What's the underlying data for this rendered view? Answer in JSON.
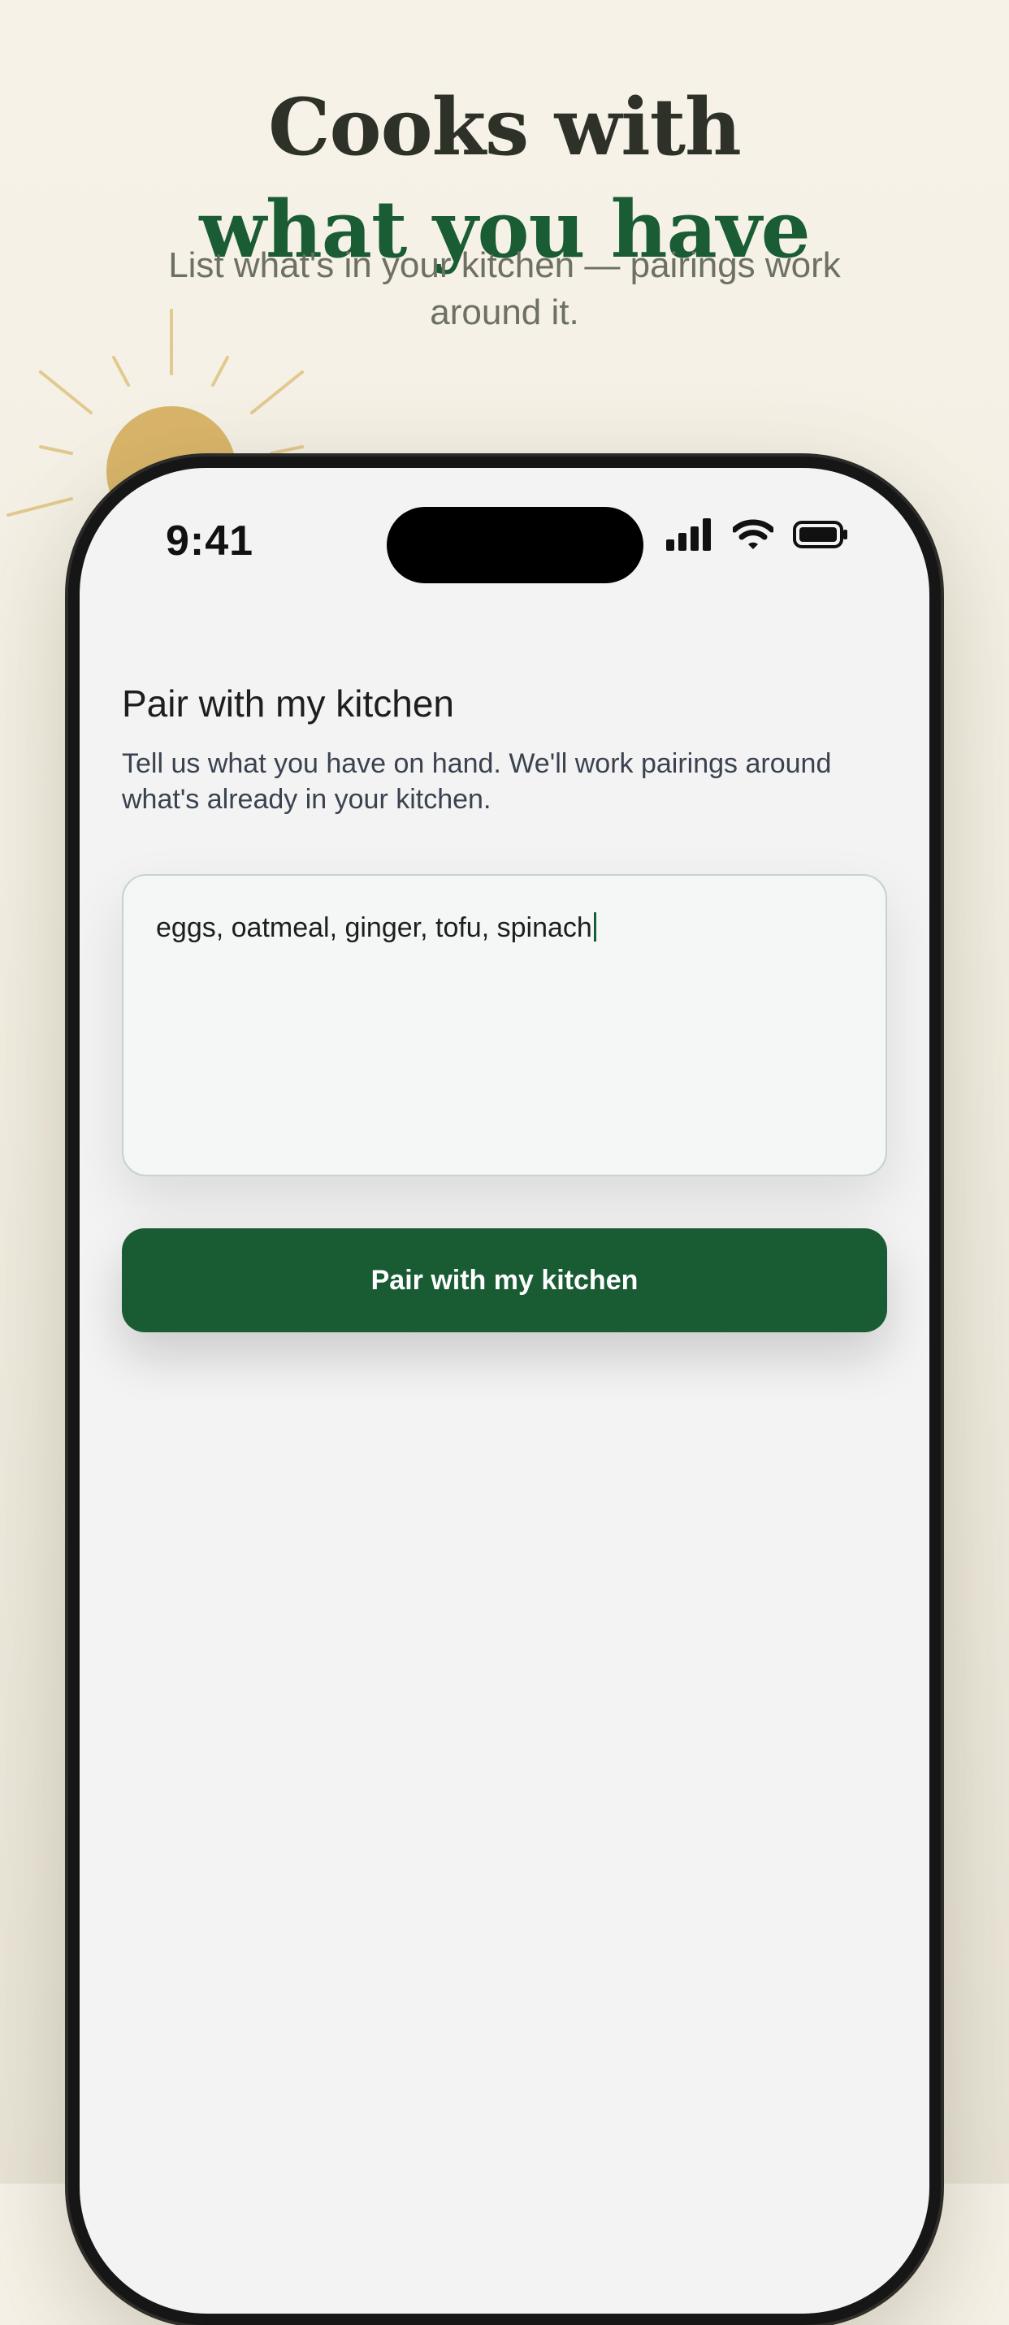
{
  "hero": {
    "title_line1": "Cooks with",
    "title_line2": "what you have",
    "subtitle": "List what's in your kitchen — pairings work around it."
  },
  "status_bar": {
    "time": "9:41",
    "icons": [
      "cellular-signal-icon",
      "wifi-icon",
      "battery-icon"
    ]
  },
  "screen": {
    "title": "Pair with my kitchen",
    "description": "Tell us what you have on hand. We'll work pairings around what's already in your kitchen.",
    "ingredients_input": {
      "value": "eggs, oatmeal, ginger, tofu, spinach"
    },
    "submit_label": "Pair with my kitchen"
  },
  "colors": {
    "background": "#f6f2e8",
    "title_dark": "#2d3128",
    "accent_green": "#1a5c33",
    "button_green": "#195c33",
    "sun": "#d9b56a"
  }
}
